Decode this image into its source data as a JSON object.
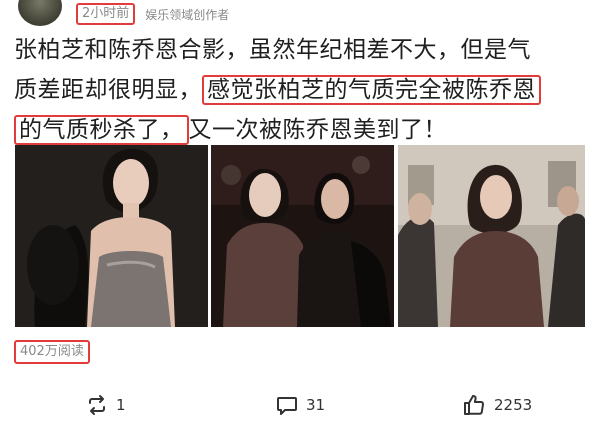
{
  "post": {
    "time": "2小时前",
    "source": "娱乐领域创作者",
    "text_lines": [
      {
        "before": "张柏芝和陈乔恩合影，虽然年纪相差不大，但是气",
        "highlight": "",
        "after": ""
      },
      {
        "before": "质差距却很明显，",
        "highlight": "感觉张柏芝的气质完全被陈乔恩",
        "after": ""
      },
      {
        "before": "",
        "highlight": "的气质秒杀了，",
        "after": "又一次被陈乔恩美到了！"
      }
    ],
    "views": "402万阅读"
  },
  "actions": {
    "repost": {
      "icon": "repost-icon",
      "count": "1"
    },
    "comment": {
      "icon": "comment-icon",
      "count": "31"
    },
    "like": {
      "icon": "thumbs-up-icon",
      "count": "2253"
    }
  },
  "colors": {
    "highlight_border": "#e23b3b",
    "meta_text": "#8a8a8a",
    "body_text": "#1f1f1f"
  }
}
